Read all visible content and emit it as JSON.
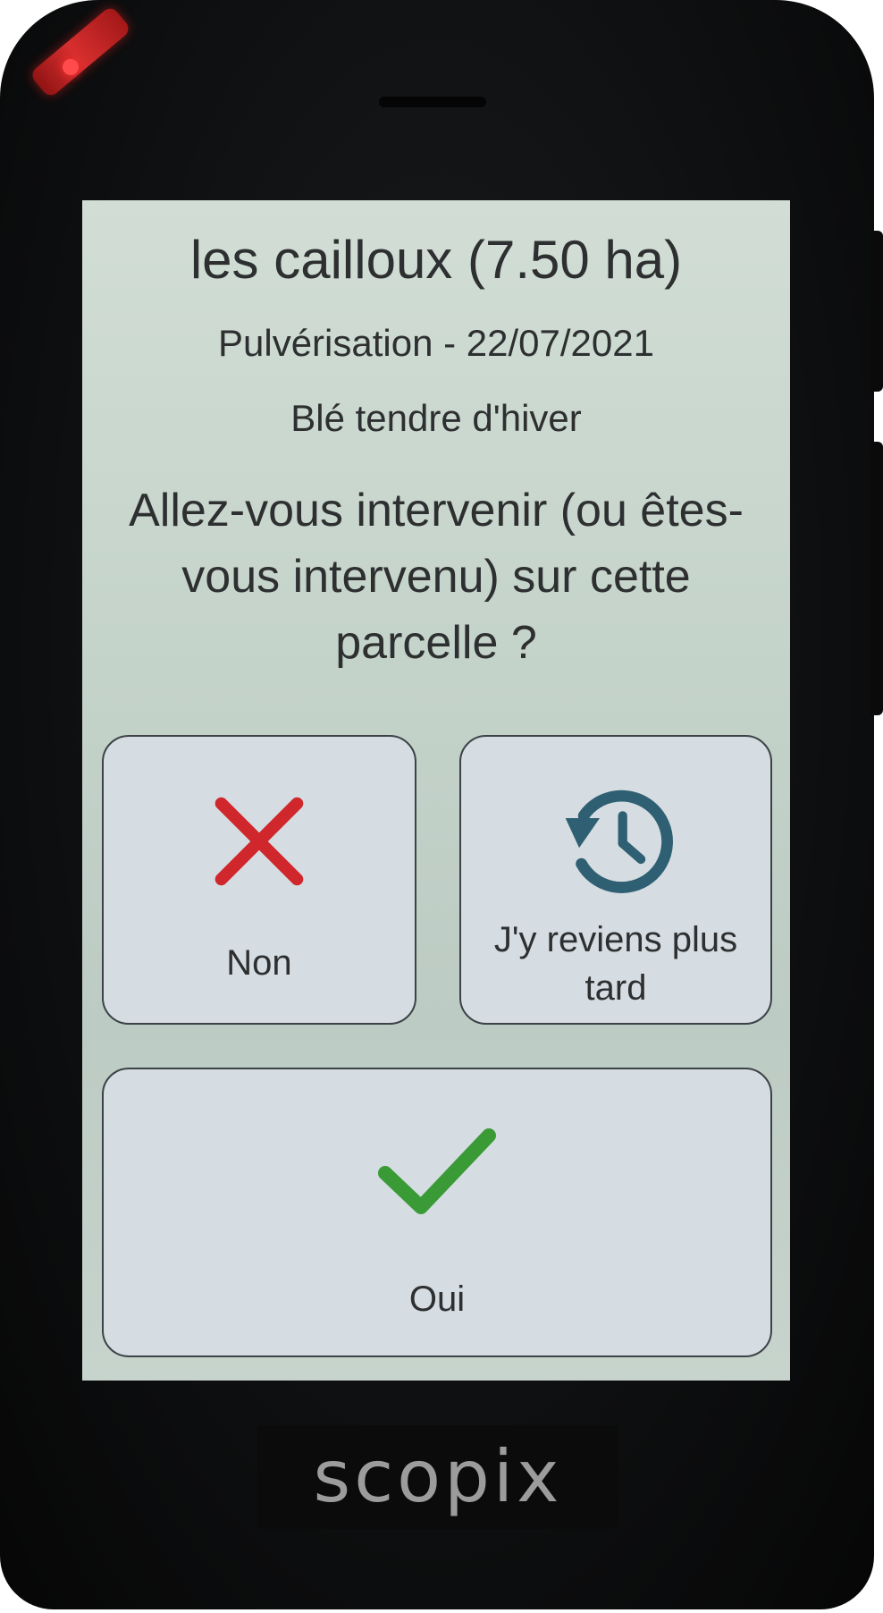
{
  "card": {
    "title": "les cailloux (7.50 ha)",
    "subtitle": "Pulvérisation - 22/07/2021",
    "crop": "Blé tendre d'hiver",
    "question": "Allez-vous intervenir (ou êtes-vous intervenu) sur cette parcelle ?"
  },
  "buttons": {
    "non": {
      "label": "Non",
      "icon": "close-icon",
      "color": "#d0272d"
    },
    "later": {
      "label": "J'y reviens plus tard",
      "icon": "history-icon",
      "color": "#2f5f72"
    },
    "oui": {
      "label": "Oui",
      "icon": "check-icon",
      "color": "#3a9a35"
    }
  },
  "device": {
    "brand": "scopix"
  }
}
